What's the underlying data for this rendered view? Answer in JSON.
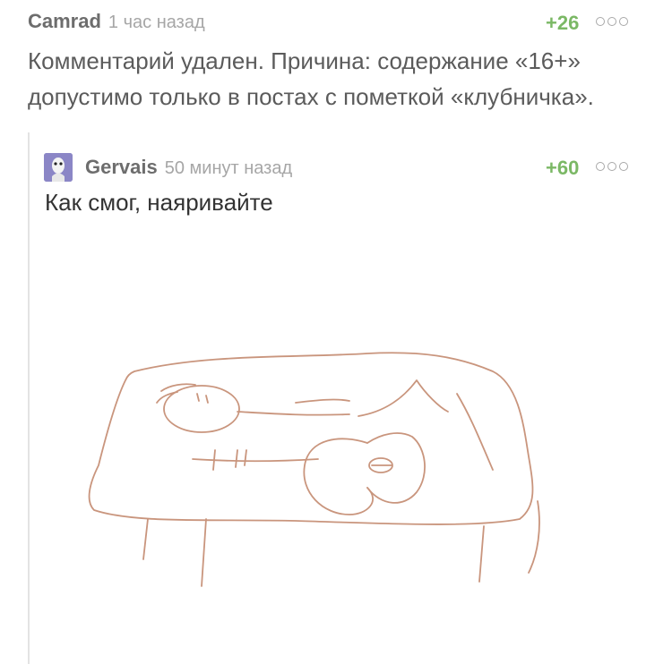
{
  "parent_comment": {
    "author": "Camrad",
    "time": "1 час назад",
    "rating": "+26",
    "text_line1": "Комментарий удален. Причина: содержание «16+»",
    "text_line2": "допустимо только в постах с пометкой «клубничка»."
  },
  "reply_comment": {
    "author": "Gervais",
    "time": "50 минут назад",
    "rating": "+60",
    "text": "Как смог, наяривайте"
  },
  "colors": {
    "rating_positive": "#7bb865",
    "drawing_stroke": "#c9957d",
    "avatar_bg": "#8b86c6"
  },
  "icons": {
    "more": "more-dots-icon",
    "avatar": "avatar-image"
  }
}
